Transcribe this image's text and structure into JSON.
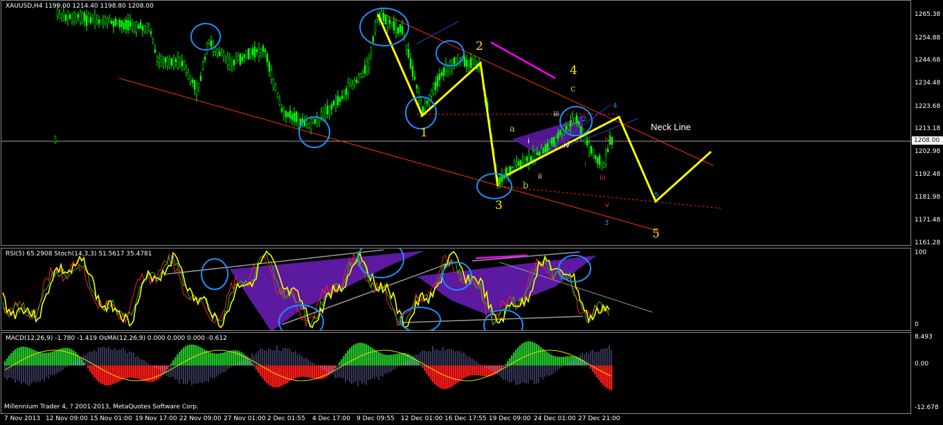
{
  "main_title": "XAUUSD,H4  1199.00 1214.40 1198.80 1208.00",
  "price_axis": [
    "1265.38",
    "1254.88",
    "1244.68",
    "1234.48",
    "1223.68",
    "1213.18",
    "1202.98",
    "1192.48",
    "1181.98",
    "1171.48",
    "1161.28"
  ],
  "current_price": "1208.00",
  "rsi_title": "RSI(5) 65.2908  Stoch(14,3,3) 51.5617 35.4781",
  "rsi_axis": [
    "100",
    "0"
  ],
  "macd_title": "MACD(12,26,9) -1.780 -1.419  OsMA(12,26,9) 0.000 0.000 0.000 -0.612",
  "macd_axis": [
    "8.493",
    "0.00",
    "-12.678"
  ],
  "copyright": "Millennium Trader 4, ? 2001-2013, MetaQuotes Software Corp.",
  "time_axis": [
    "7 Nov 2013",
    "12 Nov 09:00",
    "15 Nov 01:00",
    "19 Nov 17:00",
    "22 Nov 09:00",
    "27 Nov 01:00",
    "2 Dec 01:55",
    "4 Dec 17:00",
    "9 Dec 09:55",
    "12 Dec 01:00",
    "16 Dec 17:55",
    "19 Dec 09:00",
    "24 Dec 01:00",
    "27 Dec 21:00"
  ],
  "annotations": {
    "wave_1": "1",
    "wave_2": "2",
    "wave_3": "3",
    "wave_4": "4",
    "wave_5": "5",
    "wave_a": "a",
    "wave_b": "b",
    "wave_c": "c",
    "r_i": "i",
    "r_ii": "ii",
    "r_iii": "iii",
    "r_iv": "iv",
    "r_i2": "i",
    "r_iii2": "iii",
    "r_iv2": "iv",
    "r_v": "v",
    "b_2": "2",
    "b_3": "3",
    "b_4": "4",
    "b_5": "5",
    "neck_line": "Neck Line"
  },
  "colors": {
    "bull_candle": "#00ff00",
    "channel": "#ff3300",
    "yellow_path": "#ffff00",
    "circle": "#1e90ff",
    "wedge": "#5b1aa0",
    "magenta": "#ff00ff",
    "macd_pos": "#22c22a",
    "macd_neg": "#ff1a1a"
  }
}
